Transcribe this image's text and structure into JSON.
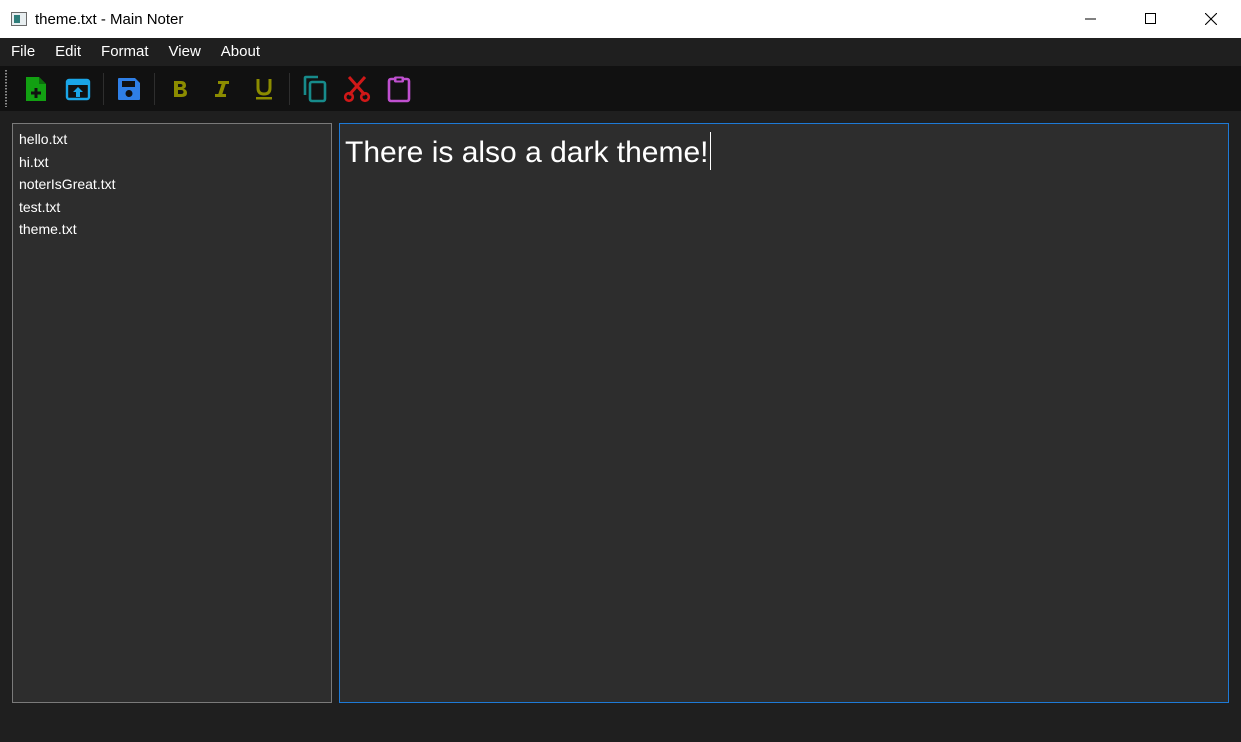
{
  "window": {
    "title": "theme.txt - Main Noter",
    "controls": [
      "minimize",
      "maximize",
      "close"
    ]
  },
  "menu": {
    "items": [
      "File",
      "Edit",
      "Format",
      "View",
      "About"
    ]
  },
  "toolbar": {
    "buttons": [
      {
        "name": "new-file-icon",
        "color": "#12a012"
      },
      {
        "name": "open-file-icon",
        "color": "#1aa6e8"
      },
      {
        "name": "save-icon",
        "color": "#2f7fe6"
      },
      {
        "name": "bold-icon",
        "color": "#8c8c00"
      },
      {
        "name": "italic-icon",
        "color": "#8c8c00"
      },
      {
        "name": "underline-icon",
        "color": "#8c8c00"
      },
      {
        "name": "copy-icon",
        "color": "#178b8b"
      },
      {
        "name": "cut-icon",
        "color": "#d01818"
      },
      {
        "name": "paste-icon",
        "color": "#c050d0"
      }
    ]
  },
  "files": {
    "items": [
      "hello.txt",
      "hi.txt",
      "noterIsGreat.txt",
      "test.txt",
      "theme.txt"
    ]
  },
  "editor": {
    "content": "There is also a dark theme!"
  },
  "colors": {
    "background": "#1f1f1f",
    "panel": "#2d2d2d",
    "focus_border": "#1e7ad6"
  }
}
